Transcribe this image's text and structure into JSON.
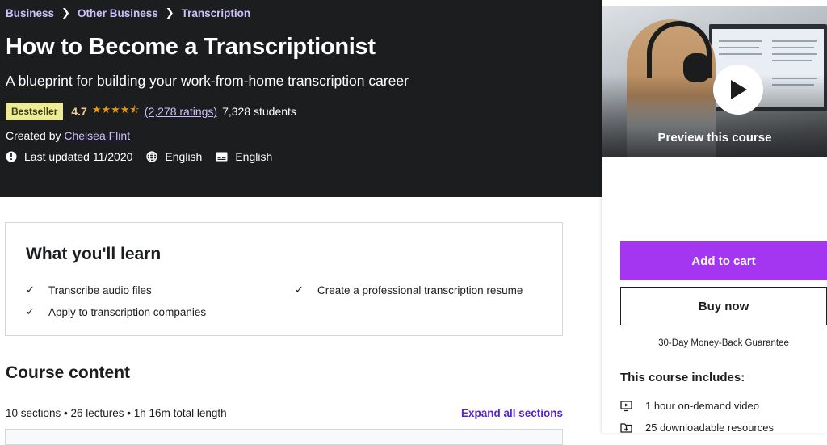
{
  "breadcrumb": [
    "Business",
    "Other Business",
    "Transcription"
  ],
  "course": {
    "title": "How to Become a Transcriptionist",
    "subtitle": "A blueprint for building your work-from-home transcription career",
    "badge": "Bestseller",
    "rating": "4.7",
    "stars": "★★★★⯪",
    "ratings_count": "(2,278 ratings)",
    "students": "7,328 students",
    "created_by_label": "Created by",
    "instructor": "Chelsea Flint",
    "last_updated": "Last updated 11/2020",
    "language": "English",
    "captions": "English"
  },
  "sidebar": {
    "preview_label": "Preview this course",
    "add_to_cart": "Add to cart",
    "buy_now": "Buy now",
    "guarantee": "30-Day Money-Back Guarantee",
    "includes_title": "This course includes:",
    "includes": [
      {
        "icon": "video-icon",
        "label": "1 hour on-demand video"
      },
      {
        "icon": "download-folder-icon",
        "label": "25 downloadable resources"
      }
    ]
  },
  "learn": {
    "title": "What you'll learn",
    "items": [
      "Transcribe audio files",
      "Create a professional transcription resume",
      "Apply to transcription companies"
    ],
    "check_glyph": "✓"
  },
  "content": {
    "title": "Course content",
    "meta": "10 sections • 26 lectures • 1h 16m total length",
    "expand_all": "Expand all sections"
  },
  "colors": {
    "hero_bg": "#1c1d1f",
    "accent_purple": "#a435f0",
    "link_purple": "#5624d0",
    "breadcrumb_purple": "#cec0fc",
    "badge_yellow": "#eceb98",
    "star_orange": "#e59819"
  }
}
